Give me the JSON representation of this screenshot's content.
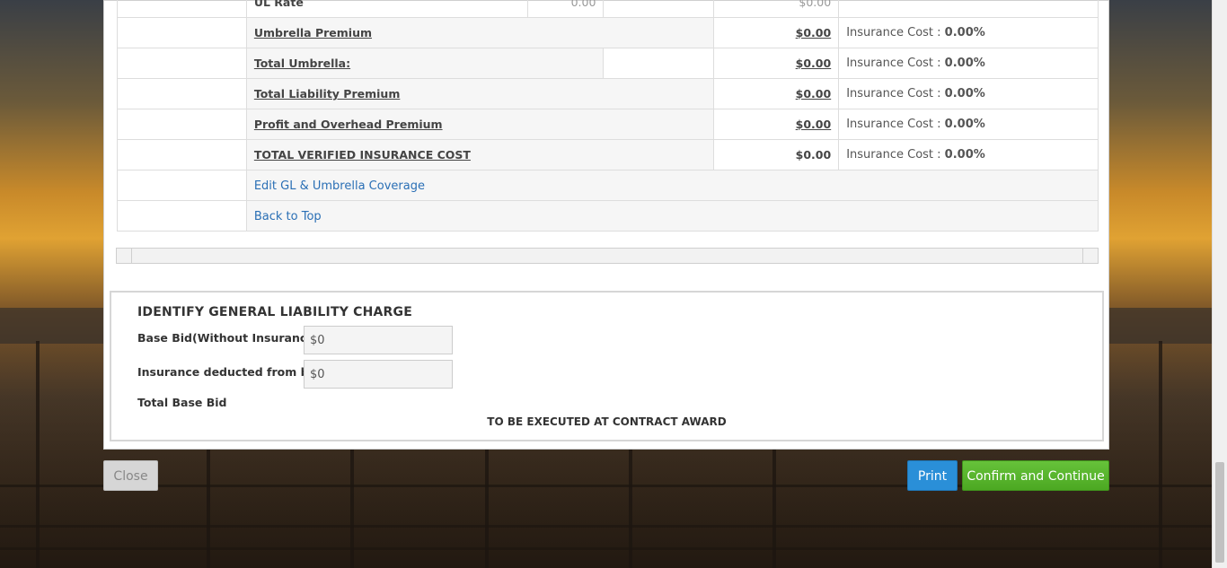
{
  "rows": {
    "ul_rate": {
      "label": "UL Rate",
      "val_a": "0.00",
      "val_b": "$0.00"
    },
    "umbrella_premium": {
      "label": "Umbrella Premium",
      "amount": "$0.00",
      "note_label": "Insurance Cost :",
      "note_value": "0.00%"
    },
    "total_umbrella": {
      "label": "Total Umbrella:",
      "amount": "$0.00",
      "note_label": "Insurance Cost :",
      "note_value": "0.00%"
    },
    "total_liability": {
      "label": "Total Liability Premium",
      "amount": "$0.00",
      "note_label": "Insurance Cost :",
      "note_value": "0.00%"
    },
    "profit_overhead": {
      "label": "Profit and Overhead Premium",
      "amount": "$0.00",
      "note_label": "Insurance Cost :",
      "note_value": "0.00%"
    },
    "total_verified": {
      "label": "TOTAL VERIFIED INSURANCE COST",
      "amount": "$0.00",
      "note_label": "Insurance Cost :",
      "note_value": "0.00%"
    }
  },
  "links": {
    "edit_coverage": "Edit GL & Umbrella Coverage",
    "back_to_top": "Back to Top"
  },
  "gl_section": {
    "title": "IDENTIFY GENERAL LIABILITY CHARGE",
    "base_bid_label": "Base Bid(Without Insurance)",
    "base_bid_value": "$0",
    "insurance_deducted_label": "Insurance deducted from bid",
    "insurance_deducted_value": "$0",
    "required_mark": "*",
    "total_base_bid_label": "Total Base Bid",
    "execution_note": "TO BE EXECUTED AT CONTRACT AWARD"
  },
  "buttons": {
    "close": "Close",
    "print": "Print",
    "confirm": "Confirm and Continue"
  },
  "colors": {
    "link": "#2a6fb5",
    "print_button": "#2a8fd8",
    "confirm_button": "#4ca822",
    "required": "#d9232e"
  }
}
